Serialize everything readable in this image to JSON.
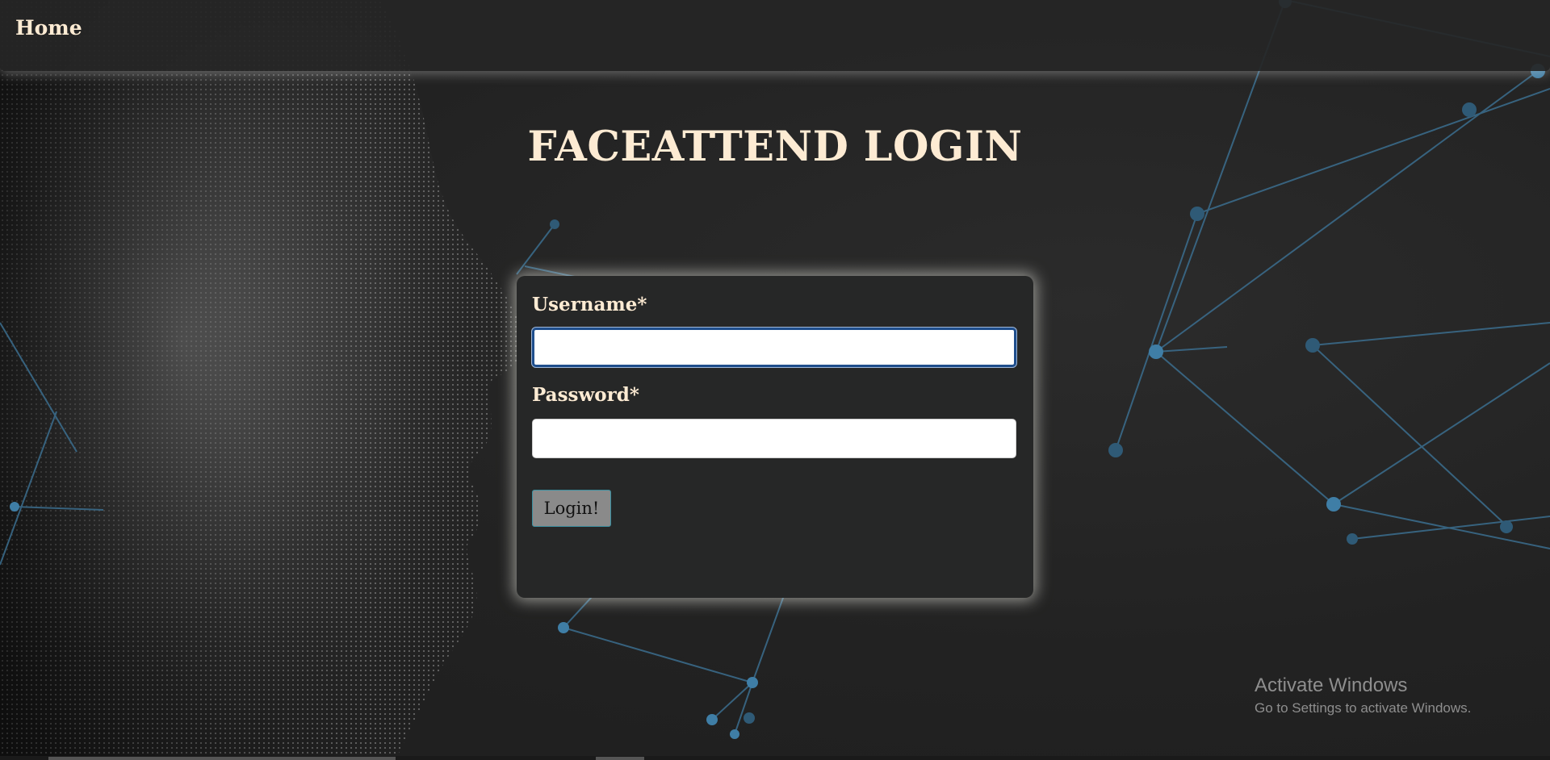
{
  "nav": {
    "home_label": "Home"
  },
  "page": {
    "title": "FACEATTEND LOGIN"
  },
  "form": {
    "username_label": "Username*",
    "username_value": "",
    "password_label": "Password*",
    "password_value": "",
    "submit_label": "Login!"
  },
  "watermark": {
    "title": "Activate Windows",
    "subtitle": "Go to Settings to activate Windows."
  },
  "colors": {
    "background": "#232323",
    "title_text": "#fdebd3",
    "card": "#262727",
    "network_lines": "#3b6e8f",
    "input_focus_border": "#1f4e8c",
    "button": "#8a8a8a"
  },
  "icons": {
    "background_face": "face-dot-portrait-art",
    "background_network": "network-graph-art"
  }
}
